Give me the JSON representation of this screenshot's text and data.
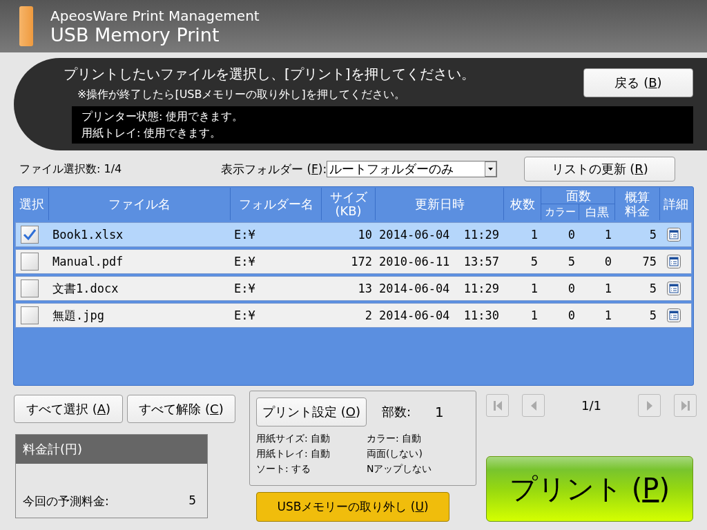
{
  "header": {
    "product": "ApeosWare Print Management",
    "title": "USB Memory Print"
  },
  "message": {
    "instruction": "プリントしたいファイルを選択し、[プリント]を押してください。",
    "note": "※操作が終了したら[USBメモリーの取り外し]を押してください。",
    "status_lines": [
      "プリンター状態: 使用できます。",
      "用紙トレイ: 使用できます。"
    ]
  },
  "back_button": {
    "before": "戻る (",
    "key": "B",
    "after": ")"
  },
  "file_count": "ファイル選択数: 1/4",
  "folder_filter": {
    "before": "表示フォルダー (",
    "key": "F",
    "after": "):",
    "value": "ルートフォルダーのみ"
  },
  "refresh_button": {
    "before": "リストの更新 (",
    "key": "R",
    "after": ")"
  },
  "table": {
    "columns": [
      {
        "lines": [
          "選択"
        ]
      },
      {
        "lines": [
          "ファイル名"
        ]
      },
      {
        "lines": [
          "フォルダー名"
        ]
      },
      {
        "lines": [
          "サイズ",
          "(KB)"
        ]
      },
      {
        "lines": [
          "更新日時"
        ]
      },
      {
        "lines": [
          "枚数"
        ]
      },
      {
        "lines": [
          "面数"
        ],
        "sub": [
          "カラー",
          "白黒"
        ]
      },
      {
        "lines": [
          "概算",
          "料金"
        ]
      },
      {
        "lines": [
          "詳細"
        ]
      }
    ],
    "rows": [
      {
        "selected": true,
        "checked": true,
        "name": "Book1.xlsx",
        "folder": "E:¥",
        "size": "10",
        "modified": "2014-06-04  11:29",
        "sheets": "1",
        "color_sides": "0",
        "mono_sides": "1",
        "cost": "5"
      },
      {
        "selected": false,
        "checked": false,
        "name": "Manual.pdf",
        "folder": "E:¥",
        "size": "172",
        "modified": "2010-06-11  13:57",
        "sheets": "5",
        "color_sides": "5",
        "mono_sides": "0",
        "cost": "75"
      },
      {
        "selected": false,
        "checked": false,
        "name": "文書1.docx",
        "folder": "E:¥",
        "size": "13",
        "modified": "2014-06-04  11:29",
        "sheets": "1",
        "color_sides": "0",
        "mono_sides": "1",
        "cost": "5"
      },
      {
        "selected": false,
        "checked": false,
        "name": "無題.jpg",
        "folder": "E:¥",
        "size": "2",
        "modified": "2014-06-04  11:30",
        "sheets": "1",
        "color_sides": "0",
        "mono_sides": "1",
        "cost": "5"
      }
    ]
  },
  "select_buttons": [
    {
      "before": "すべて選択 (",
      "key": "A",
      "after": ")"
    },
    {
      "before": "すべて解除 (",
      "key": "C",
      "after": ")"
    }
  ],
  "cost_panel": {
    "title": "料金計(円)",
    "label": "今回の予測料金:",
    "value": "5"
  },
  "print_settings": {
    "button": {
      "before": "プリント設定 (",
      "key": "O",
      "after": ")"
    },
    "copies_label": "部数:",
    "copies": "1",
    "settings": [
      "用紙サイズ: 自動",
      "カラー: 自動",
      "用紙トレイ: 自動",
      "両面(しない)",
      "ソート: する",
      "Nアップしない"
    ]
  },
  "remove_usb_button": {
    "before": "USBメモリーの取り外し (",
    "key": "U",
    "after": ")"
  },
  "pager": {
    "page": "1/1",
    "buttons": [
      {
        "kind": "first",
        "disabled": true
      },
      {
        "kind": "prev",
        "disabled": true
      },
      {
        "kind": "next",
        "disabled": true
      },
      {
        "kind": "last",
        "disabled": true
      }
    ]
  },
  "print_button": {
    "before": "プリント (",
    "key": "P",
    "after": ")"
  }
}
